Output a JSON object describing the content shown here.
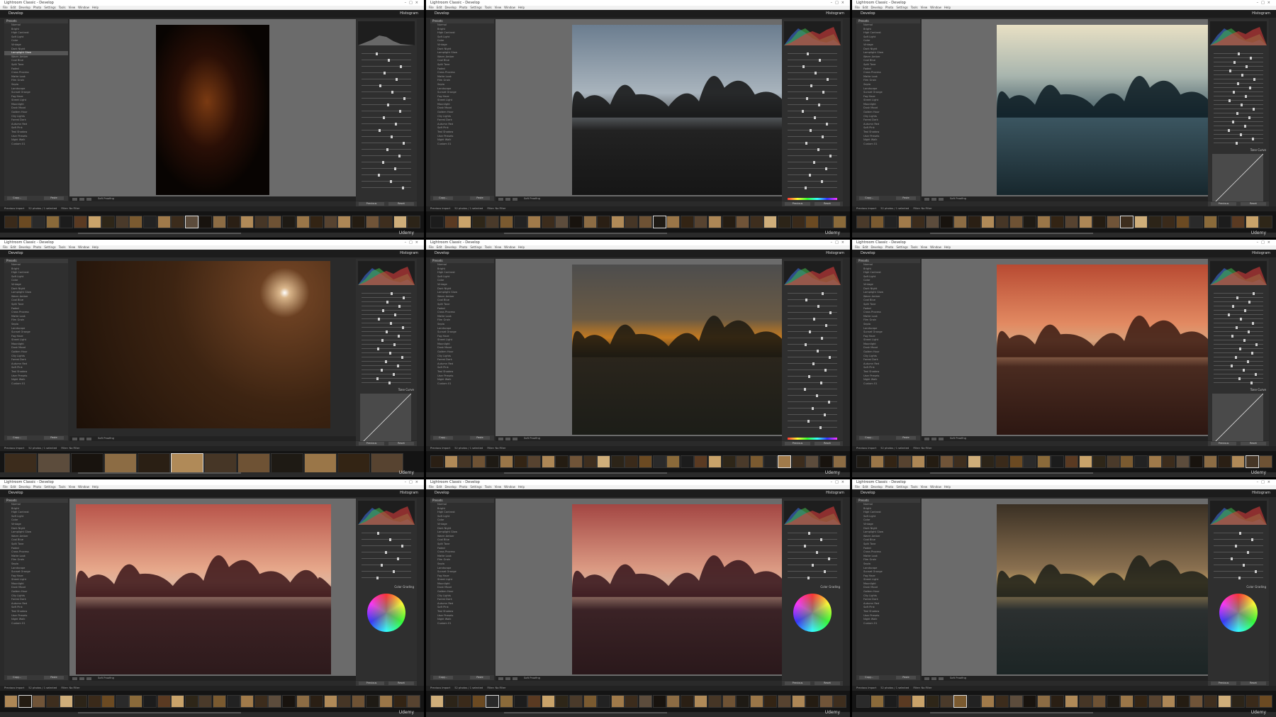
{
  "app": {
    "title": "Lightroom Classic - Develop",
    "menus": [
      "File",
      "Edit",
      "Develop",
      "Photo",
      "Settings",
      "Tools",
      "View",
      "Window",
      "Help"
    ],
    "module": "Develop",
    "panel_header": "Histogram",
    "watermark": "Udemy"
  },
  "left_panel": {
    "header": "Presets",
    "items": [
      "Normal",
      "Bright",
      "High Contrast",
      "Soft Light",
      "Color",
      "Vintage",
      "Dark Night",
      "Lamplight Glow",
      "Warm Amber",
      "Cool Blue",
      "Split Tone",
      "Faded",
      "Cross Process",
      "Matte Look",
      "Film Grain",
      "Sepia",
      "Landscape",
      "Sunset Orange",
      "Fog Haze",
      "Street Light",
      "Moonlight",
      "Dusk Mood",
      "Golden Hour",
      "City Lights",
      "Forest Dark",
      "Autumn Red",
      "Soft Pink",
      "Teal Shadow",
      "User Presets",
      "Night Walk",
      "Custom 01"
    ],
    "copy_label": "Copy...",
    "paste_label": "Paste"
  },
  "right_panel": {
    "previous_label": "Previous",
    "reset_label": "Reset",
    "tone_curve_label": "Tone Curve",
    "color_grading_label": "Color Grading"
  },
  "toolbar": {
    "soft_proofing_label": "Soft Proofing"
  },
  "filmstrip": {
    "source_label": "Previous Import",
    "count_label": "52 photos / 1 selected",
    "filter_label": "Filter: No Filter"
  },
  "tiles": [
    {
      "photo": "night-path-lamp",
      "panel_mode": "basic"
    },
    {
      "photo": "foggy-trees-moon",
      "panel_mode": "hsl"
    },
    {
      "photo": "foggy-trees-teal",
      "panel_mode": "curve"
    },
    {
      "photo": "fog-moon-amber",
      "panel_mode": "curve"
    },
    {
      "photo": "city-glow-field-dark",
      "panel_mode": "hsl"
    },
    {
      "photo": "city-glow-field-red",
      "panel_mode": "curve"
    },
    {
      "photo": "sunset-field-pink",
      "panel_mode": "grading"
    },
    {
      "photo": "sunset-field-pink-2",
      "panel_mode": "grading"
    },
    {
      "photo": "city-glow-teal",
      "panel_mode": "grading"
    }
  ],
  "colors": {
    "titlebar": "#ffffff",
    "panel": "#2f2f2f",
    "center": "#6b6b6b",
    "filmstrip": "#141414"
  }
}
